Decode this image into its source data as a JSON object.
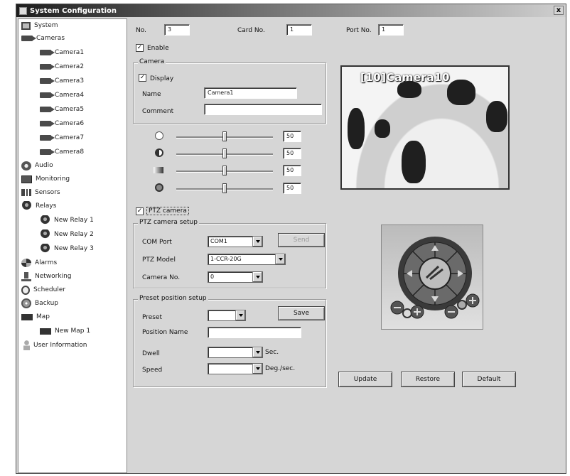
{
  "window": {
    "title": "System Configuration",
    "close": "x"
  },
  "tree": {
    "system": "System",
    "cameras": "Cameras",
    "camera_items": [
      "Camera1",
      "Camera2",
      "Camera3",
      "Camera4",
      "Camera5",
      "Camera6",
      "Camera7",
      "Camera8"
    ],
    "audio": "Audio",
    "monitoring": "Monitoring",
    "sensors": "Sensors",
    "relays": "Relays",
    "relay_items": [
      "New Relay 1",
      "New Relay 2",
      "New Relay 3"
    ],
    "alarms": "Alarms",
    "networking": "Networking",
    "scheduler": "Scheduler",
    "backup": "Backup",
    "map": "Map",
    "map_items": [
      "New Map 1"
    ],
    "user_information": "User Information"
  },
  "header": {
    "no_label": "No.",
    "no_value": "3",
    "card_no_label": "Card No.",
    "card_no_value": "1",
    "port_no_label": "Port No.",
    "port_no_value": "1"
  },
  "enable": {
    "label": "Enable",
    "checked": true
  },
  "camera_group": {
    "legend": "Camera",
    "display_label": "Display",
    "display_checked": true,
    "name_label": "Name",
    "name_value": "Camera1",
    "comment_label": "Comment",
    "comment_value": ""
  },
  "sliders": [
    {
      "icon": "brightness-icon",
      "value": "50"
    },
    {
      "icon": "contrast-icon",
      "value": "50"
    },
    {
      "icon": "color-icon",
      "value": "50"
    },
    {
      "icon": "hue-icon",
      "value": "50"
    }
  ],
  "preview": {
    "overlay": "[10]Camera10"
  },
  "ptz": {
    "checkbox_label": "PTZ camera",
    "checked": true,
    "setup_legend": "PTZ camera setup",
    "com_port_label": "COM Port",
    "com_port_value": "COM1",
    "send_label": "Send",
    "model_label": "PTZ Model",
    "model_value": "1-CCR-20G",
    "camera_no_label": "Camera No.",
    "camera_no_value": "0"
  },
  "preset": {
    "legend": "Preset position setup",
    "preset_label": "Preset",
    "preset_value": "",
    "save_label": "Save",
    "position_name_label": "Position Name",
    "position_name_value": "",
    "dwell_label": "Dwell",
    "dwell_value": "",
    "dwell_unit": "Sec.",
    "speed_label": "Speed",
    "speed_value": "",
    "speed_unit": "Deg./sec."
  },
  "actions": {
    "update": "Update",
    "restore": "Restore",
    "default": "Default"
  }
}
